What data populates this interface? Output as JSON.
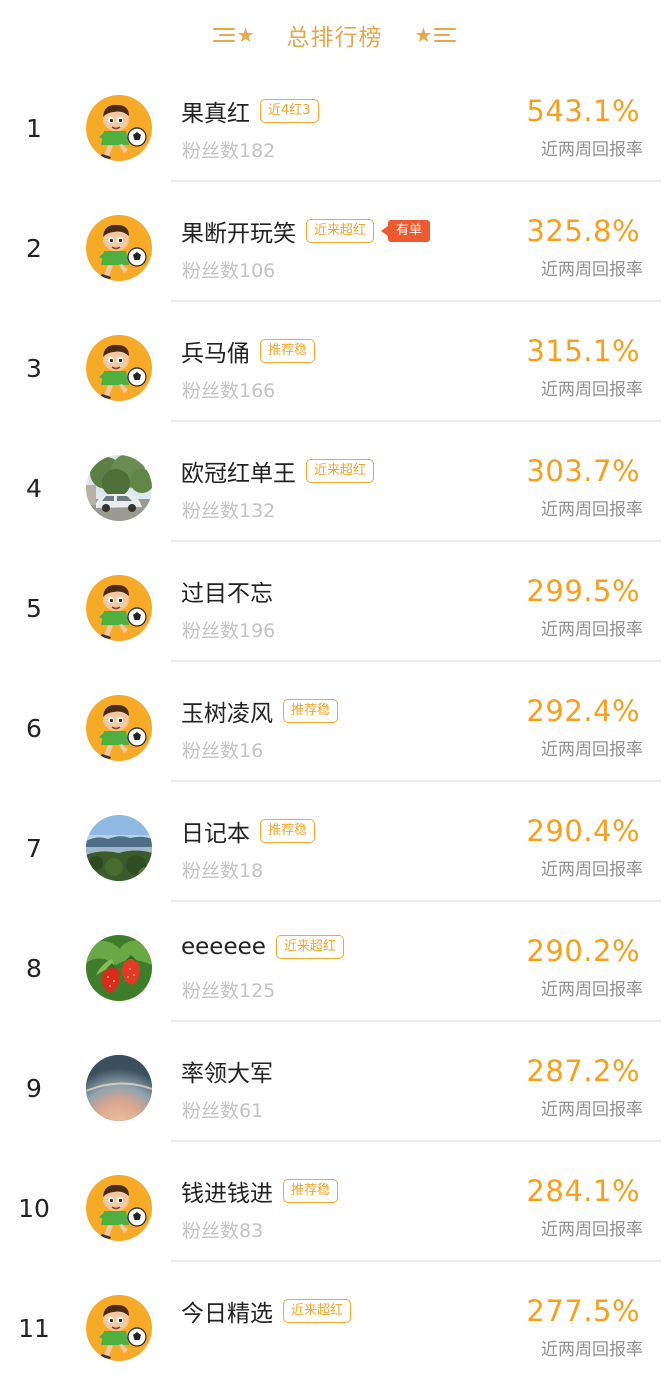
{
  "header": {
    "title": "总排行榜"
  },
  "colors": {
    "accent": "#f5a01e",
    "tag": "#f3a72c",
    "hot_badge": "#ee5a2f",
    "title": "#e5a84b"
  },
  "ranking": [
    {
      "rank": "1",
      "name": "果真红",
      "tag": "近4红3",
      "badge": "",
      "fans": "粉丝数182",
      "return_rate": "543.1%",
      "return_label": "近两周回报率",
      "avatar": "soccer-boy"
    },
    {
      "rank": "2",
      "name": "果断开玩笑",
      "tag": "近来超红",
      "badge": "有单",
      "fans": "粉丝数106",
      "return_rate": "325.8%",
      "return_label": "近两周回报率",
      "avatar": "soccer-boy"
    },
    {
      "rank": "3",
      "name": "兵马俑",
      "tag": "推荐稳",
      "badge": "",
      "fans": "粉丝数166",
      "return_rate": "315.1%",
      "return_label": "近两周回报率",
      "avatar": "soccer-boy"
    },
    {
      "rank": "4",
      "name": "欧冠红单王",
      "tag": "近来超红",
      "badge": "",
      "fans": "粉丝数132",
      "return_rate": "303.7%",
      "return_label": "近两周回报率",
      "avatar": "car-tree-photo"
    },
    {
      "rank": "5",
      "name": "过目不忘",
      "tag": "",
      "badge": "",
      "fans": "粉丝数196",
      "return_rate": "299.5%",
      "return_label": "近两周回报率",
      "avatar": "soccer-boy"
    },
    {
      "rank": "6",
      "name": "玉树凌风",
      "tag": "推荐稳",
      "badge": "",
      "fans": "粉丝数16",
      "return_rate": "292.4%",
      "return_label": "近两周回报率",
      "avatar": "soccer-boy"
    },
    {
      "rank": "7",
      "name": "日记本",
      "tag": "推荐稳",
      "badge": "",
      "fans": "粉丝数18",
      "return_rate": "290.4%",
      "return_label": "近两周回报率",
      "avatar": "landscape-photo"
    },
    {
      "rank": "8",
      "name": "eeeeee",
      "tag": "近来超红",
      "badge": "",
      "fans": "粉丝数125",
      "return_rate": "290.2%",
      "return_label": "近两周回报率",
      "avatar": "strawberry-photo"
    },
    {
      "rank": "9",
      "name": "率领大军",
      "tag": "",
      "badge": "",
      "fans": "粉丝数61",
      "return_rate": "287.2%",
      "return_label": "近两周回报率",
      "avatar": "planet-photo"
    },
    {
      "rank": "10",
      "name": "钱进钱进",
      "tag": "推荐稳",
      "badge": "",
      "fans": "粉丝数83",
      "return_rate": "284.1%",
      "return_label": "近两周回报率",
      "avatar": "soccer-boy"
    },
    {
      "rank": "11",
      "name": "今日精选",
      "tag": "近来超红",
      "badge": "",
      "fans": "",
      "return_rate": "277.5%",
      "return_label": "近两周回报率",
      "avatar": "soccer-boy"
    }
  ]
}
